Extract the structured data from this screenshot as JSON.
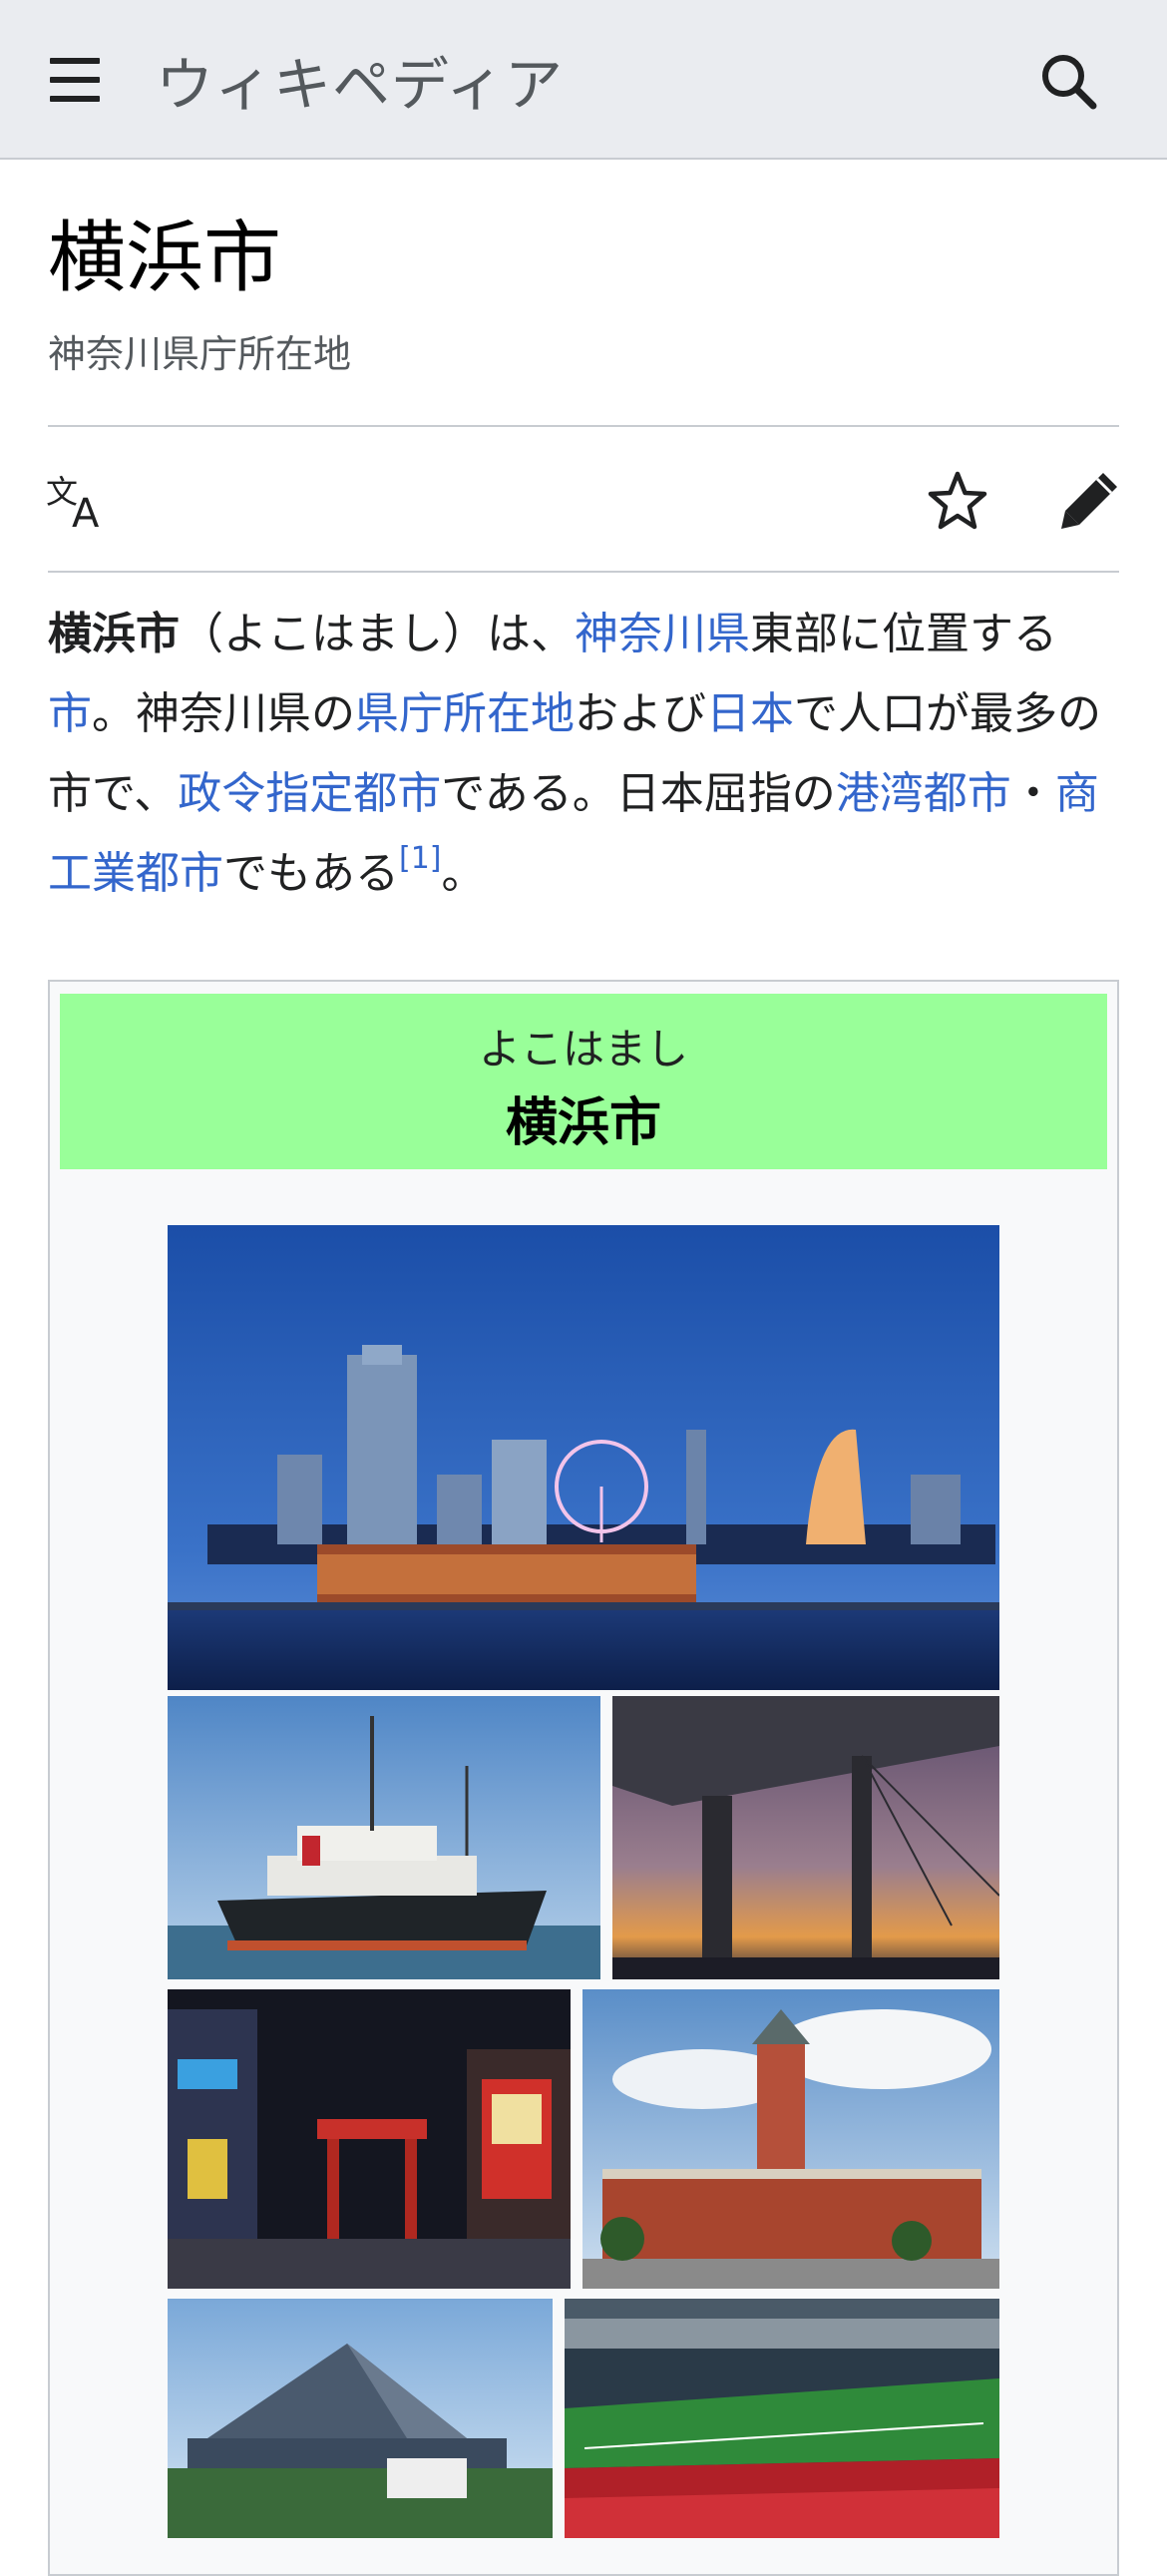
{
  "header": {
    "wordmark": "ウィキペディア"
  },
  "page": {
    "title": "横浜市",
    "description": "神奈川県庁所在地"
  },
  "article": {
    "t1": "横浜市",
    "t2": "（よこはまし）は、",
    "l1": "神奈川県",
    "t3": "東部に位置する",
    "l2": "市",
    "t4": "。神奈川県の",
    "l3": "県庁所在地",
    "t5": "および",
    "l4": "日本",
    "t6": "で人口が最多の市で、",
    "l5": "政令指定都市",
    "t7": "である。日本屈指の",
    "l6": "港湾都市",
    "t8": "・",
    "l7": "商工業都市",
    "t9": "でもある",
    "ref": "[1]",
    "t10": "。"
  },
  "infobox": {
    "reading": "よこはまし",
    "name": "横浜市",
    "header_color": "#99ff99"
  },
  "colors": {
    "link": "#3366cc",
    "header_bg": "#eaecf0"
  },
  "icons": [
    "menu-icon",
    "search-icon",
    "language-icon",
    "star-icon",
    "edit-pencil-icon"
  ]
}
